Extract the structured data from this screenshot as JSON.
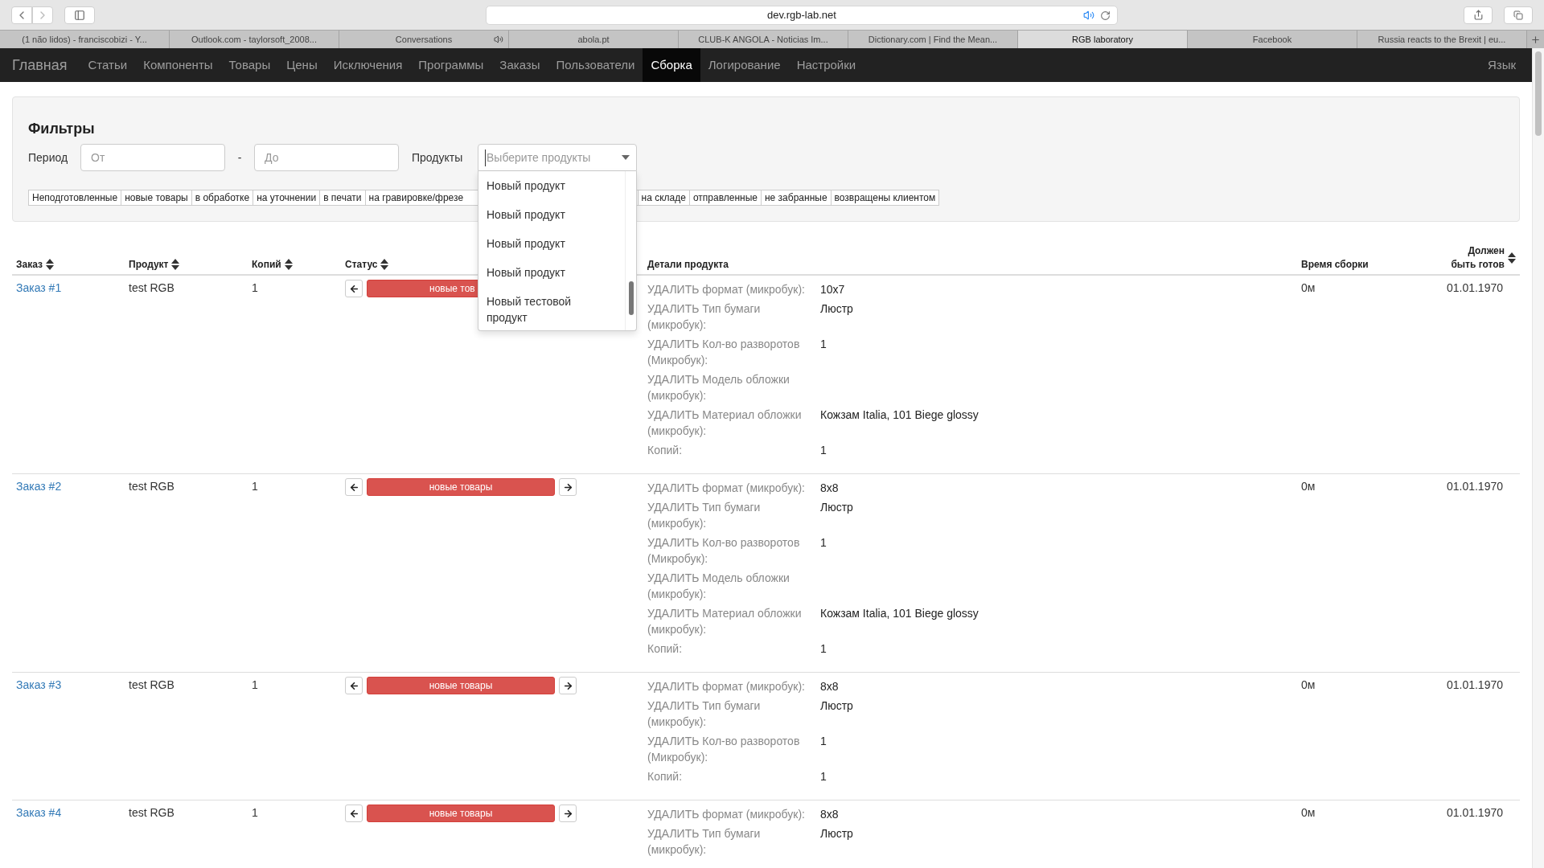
{
  "browser": {
    "address": "dev.rgb-lab.net",
    "tabs": [
      {
        "title": "(1 não lidos) - franciscobizi - Y...",
        "selected": false,
        "sound": false
      },
      {
        "title": "Outlook.com - taylorsoft_2008...",
        "selected": false,
        "sound": false
      },
      {
        "title": "Conversations",
        "selected": false,
        "sound": true
      },
      {
        "title": "abola.pt",
        "selected": false,
        "sound": false
      },
      {
        "title": "CLUB-K ANGOLA - Noticias Im...",
        "selected": false,
        "sound": false
      },
      {
        "title": "Dictionary.com | Find the Mean...",
        "selected": false,
        "sound": false
      },
      {
        "title": "RGB laboratory",
        "selected": true,
        "sound": false
      },
      {
        "title": "Facebook",
        "selected": false,
        "sound": false
      },
      {
        "title": "Russia reacts to the Brexit | eu...",
        "selected": false,
        "sound": false
      }
    ]
  },
  "nav": {
    "brand": "Главная",
    "items": [
      {
        "label": "Статьи",
        "selected": false
      },
      {
        "label": "Компоненты",
        "selected": false
      },
      {
        "label": "Товары",
        "selected": false
      },
      {
        "label": "Цены",
        "selected": false
      },
      {
        "label": "Исключения",
        "selected": false
      },
      {
        "label": "Программы",
        "selected": false
      },
      {
        "label": "Заказы",
        "selected": false
      },
      {
        "label": "Пользователи",
        "selected": false
      },
      {
        "label": "Сборка",
        "selected": true
      },
      {
        "label": "Логирование",
        "selected": false
      },
      {
        "label": "Настройки",
        "selected": false
      }
    ],
    "right": "Язык"
  },
  "filters": {
    "title": "Фильтры",
    "period_label": "Период",
    "from": {
      "placeholder": "От"
    },
    "separator": "-",
    "to": {
      "placeholder": "До"
    },
    "products_label": "Продукты",
    "products": {
      "placeholder": "Выберите продукты",
      "expanded": true,
      "options": [
        "Новый продукт",
        "Новый продукт",
        "Новый продукт",
        "Новый продукт",
        "Новый тестовой продукт"
      ]
    },
    "statuses": [
      {
        "label": "Неподготовленные",
        "covered": false
      },
      {
        "label": "новые товары",
        "covered": false
      },
      {
        "label": "в обработке",
        "covered": false
      },
      {
        "label": "на уточнении",
        "covered": false
      },
      {
        "label": "в печати",
        "covered": false
      },
      {
        "label": "на гравировке/фрезе",
        "covered": true
      },
      {
        "label": "на складе",
        "covered": false
      },
      {
        "label": "отправленные",
        "covered": false
      },
      {
        "label": "не забранные",
        "covered": false
      },
      {
        "label": "возвращены клиентом",
        "covered": false
      }
    ]
  },
  "table": {
    "columns": [
      {
        "label": "Заказ",
        "sortable": true
      },
      {
        "label": "Продукт",
        "sortable": true
      },
      {
        "label": "Копий",
        "sortable": true
      },
      {
        "label": "Статус",
        "sortable": true
      },
      {
        "label": "Детали продукта",
        "sortable": false
      },
      {
        "label": "Время сборки",
        "sortable": false
      },
      {
        "label": "Должен быть готов",
        "sortable": true
      }
    ],
    "rows": [
      {
        "order": "Заказ #1",
        "product": "test RGB",
        "copies": "1",
        "status": "новые тов",
        "status_covered": true,
        "details": [
          {
            "label": "УДАЛИТЬ формат (микробук):",
            "value": "10x7"
          },
          {
            "label": "УДАЛИТЬ Тип бумаги (микробук):",
            "value": "Люстр"
          },
          {
            "label": "УДАЛИТЬ Кол-во разворотов (Микробук):",
            "value": "1"
          },
          {
            "label": "УДАЛИТЬ Модель обложки (микробук):"
          },
          {
            "label": "УДАЛИТЬ Материал обложки (микробук):",
            "value": "Кожзам Italia, 101 Biege glossy"
          },
          {
            "label": "Копий:",
            "value": "1"
          }
        ],
        "time": "0м",
        "due": "01.01.1970"
      },
      {
        "order": "Заказ #2",
        "product": "test RGB",
        "copies": "1",
        "status": "новые товары",
        "status_covered": false,
        "details": [
          {
            "label": "УДАЛИТЬ формат (микробук):",
            "value": "8x8"
          },
          {
            "label": "УДАЛИТЬ Тип бумаги (микробук):",
            "value": "Люстр"
          },
          {
            "label": "УДАЛИТЬ Кол-во разворотов (Микробук):",
            "value": "1"
          },
          {
            "label": "УДАЛИТЬ Модель обложки (микробук):"
          },
          {
            "label": "УДАЛИТЬ Материал обложки (микробук):",
            "value": "Кожзам Italia, 101 Biege glossy"
          },
          {
            "label": "Копий:",
            "value": "1"
          }
        ],
        "time": "0м",
        "due": "01.01.1970"
      },
      {
        "order": "Заказ #3",
        "product": "test RGB",
        "copies": "1",
        "status": "новые товары",
        "status_covered": false,
        "details": [
          {
            "label": "УДАЛИТЬ формат (микробук):",
            "value": "8x8"
          },
          {
            "label": "УДАЛИТЬ Тип бумаги (микробук):",
            "value": "Люстр"
          },
          {
            "label": "УДАЛИТЬ Кол-во разворотов (Микробук):",
            "value": "1"
          },
          {
            "label": "Копий:",
            "value": "1"
          }
        ],
        "time": "0м",
        "due": "01.01.1970"
      },
      {
        "order": "Заказ #4",
        "product": "test RGB",
        "copies": "1",
        "status": "новые товары",
        "status_covered": false,
        "details": [
          {
            "label": "УДАЛИТЬ формат (микробук):",
            "value": "8x8"
          },
          {
            "label": "УДАЛИТЬ Тип бумаги (микробук):",
            "value": "Люстр"
          }
        ],
        "time": "0м",
        "due": "01.01.1970"
      }
    ]
  }
}
